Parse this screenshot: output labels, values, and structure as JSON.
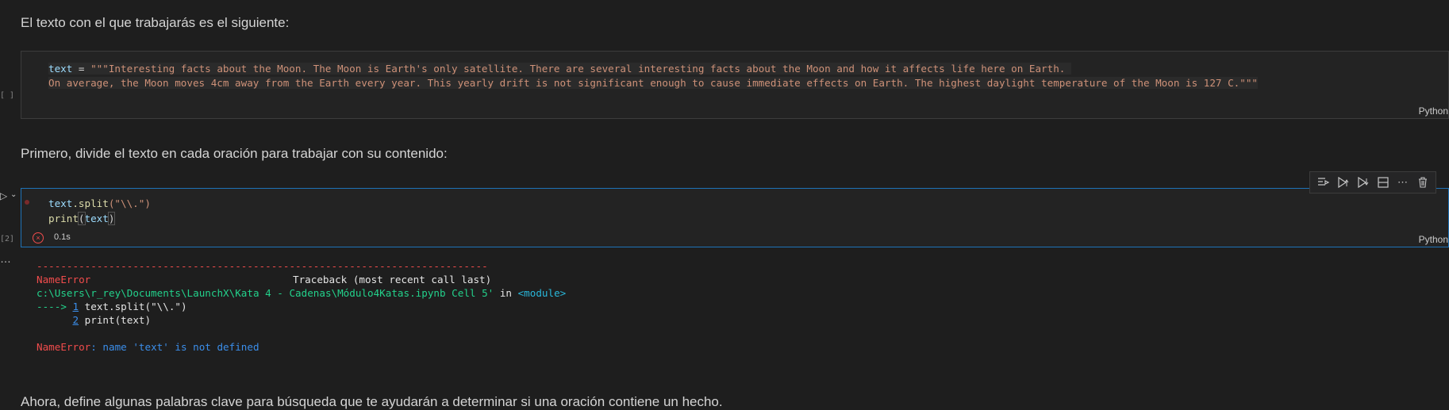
{
  "markdown": {
    "intro": "El texto con el que trabajarás es el siguiente:",
    "split_intro": "Primero, divide el texto en cada oración para trabajar con su contenido:",
    "keywords_intro": "Ahora, define algunas palabras clave para búsqueda que te ayudarán a determinar si una oración contiene un hecho."
  },
  "cell1": {
    "exec_count": "[ ]",
    "line1": {
      "var": "text",
      "op": " = ",
      "str": "\"\"\"Interesting facts about the Moon. The Moon is Earth's only satellite. There are several interesting facts about the Moon and how it affects life here on Earth. "
    },
    "line2": {
      "str": "On average, the Moon moves 4cm away from the Earth every year. This yearly drift is not significant enough to cause immediate effects on Earth. The highest daylight temperature of the Moon is 127 C.\"\"\""
    },
    "language": "Python"
  },
  "cell2": {
    "exec_count": "[2]",
    "line1": {
      "obj": "text",
      "fn": ".split",
      "args": "(\"\\\\.\")"
    },
    "line2": {
      "fn": "print",
      "open": "(",
      "arg": "text",
      "close": ")"
    },
    "status_time": "0.1s",
    "language": "Python"
  },
  "output": {
    "dashes": "---------------------------------------------------------------------------",
    "error_name": "NameError",
    "traceback_label": "Traceback (most recent call last)",
    "path": "c:\\Users\\r_rey\\Documents\\LaunchX\\Kata 4 - Cadenas\\Módulo4Katas.ipynb Cell 5'",
    "in": " in ",
    "module": "<module>",
    "arrow": "----> ",
    "line1_no": "1",
    "line1_code": " text.split(\"\\\\.\")",
    "line2_indent": "      ",
    "line2_no": "2",
    "line2_code": " print(text)",
    "final_name": "NameError",
    "final_msg": ": name 'text' is not defined"
  },
  "toolbar": {
    "icons": [
      "run-by-line-icon",
      "execute-above-icon",
      "execute-below-icon",
      "split-cell-icon",
      "more-icon",
      "delete-icon"
    ]
  }
}
